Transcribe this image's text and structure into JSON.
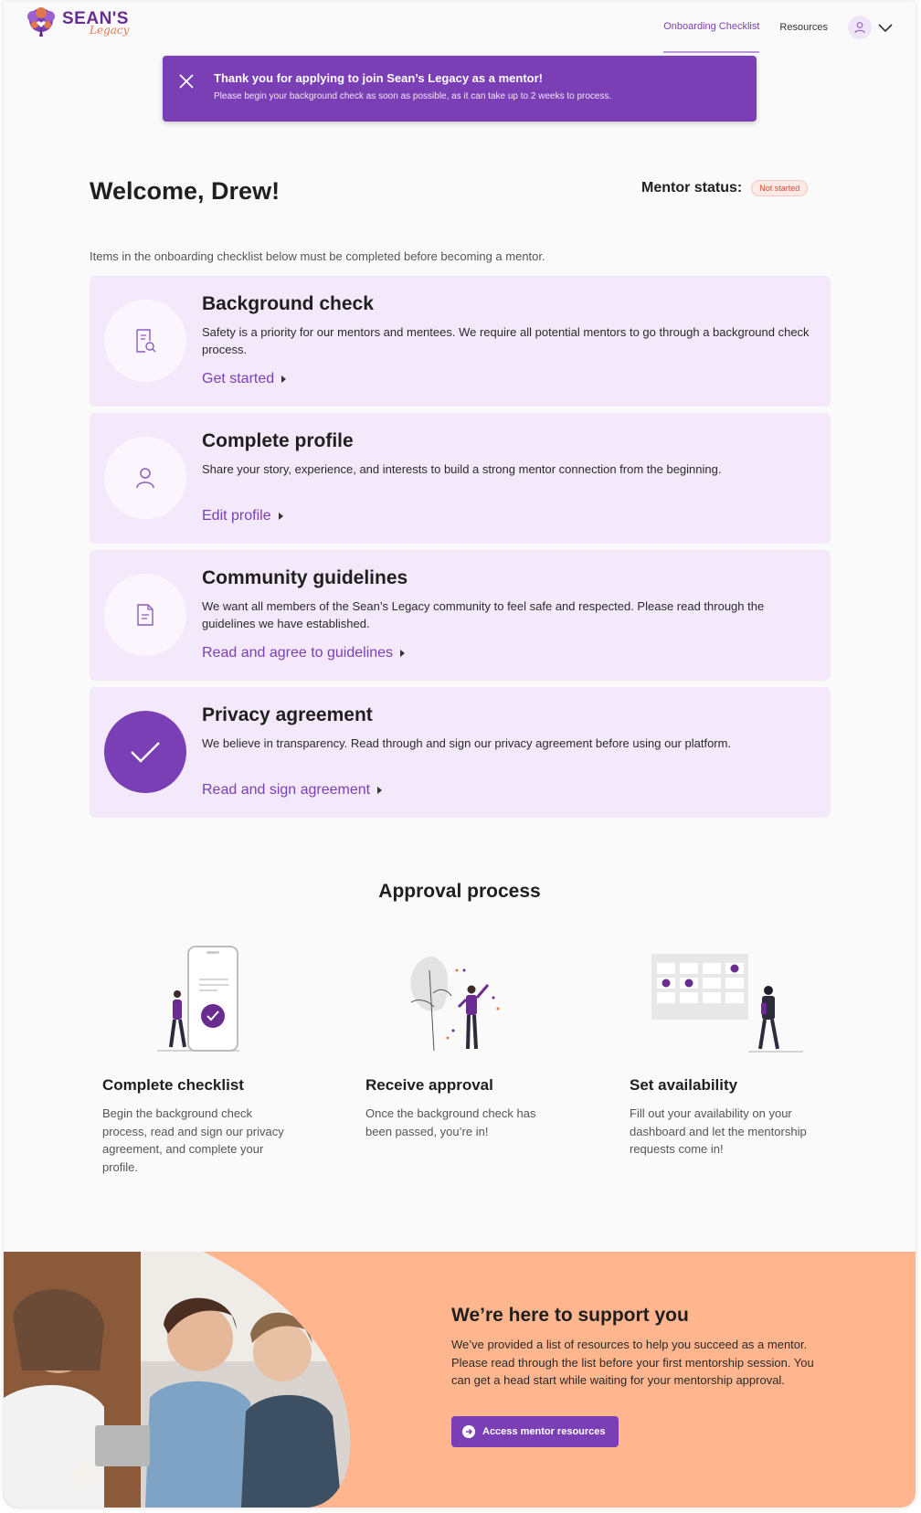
{
  "header": {
    "logo_primary": "SEAN'S",
    "logo_secondary": "Legacy",
    "nav": [
      {
        "label": "Onboarding Checklist",
        "active": true
      },
      {
        "label": "Resources",
        "active": false
      }
    ]
  },
  "banner": {
    "title": "Thank you for applying to join Sean’s Legacy as a mentor!",
    "subtitle": "Please begin your background check as soon as possible, as it can take up to 2 weeks to process."
  },
  "welcome": {
    "heading": "Welcome, Drew!",
    "status_label": "Mentor status:",
    "status_value": "Not started",
    "intro": "Items in the onboarding checklist below must be completed before becoming a mentor."
  },
  "checklist": [
    {
      "title": "Background check",
      "description": "Safety is a priority for our mentors and mentees. We require all potential mentors to go through a background check process.",
      "link": "Get started",
      "icon": "document-search-icon",
      "completed": false
    },
    {
      "title": "Complete profile",
      "description": "Share your story, experience, and interests to build a strong mentor connection from the beginning.",
      "link": "Edit profile",
      "icon": "user-icon",
      "completed": false
    },
    {
      "title": "Community guidelines",
      "description": "We want all members of the Sean’s Legacy community to feel safe and respected. Please read through the guidelines we have established.",
      "link": "Read and agree to guidelines",
      "icon": "document-icon",
      "completed": false
    },
    {
      "title": "Privacy agreement",
      "description": "We believe in transparency. Read through and sign our privacy agreement before using our platform.",
      "link": "Read and sign agreement",
      "icon": "checkmark-icon",
      "completed": true
    }
  ],
  "approval": {
    "heading": "Approval process",
    "steps": [
      {
        "title": "Complete checklist",
        "description": "Begin the background check process, read and sign our privacy agreement, and complete your profile."
      },
      {
        "title": "Receive approval",
        "description": "Once the background check has been passed, you’re in!"
      },
      {
        "title": "Set availability",
        "description": "Fill out your availability on your dashboard and let the mentorship requests come in!"
      }
    ]
  },
  "support": {
    "heading": "We’re here to support you",
    "description": "We’ve provided a list of resources to help you succeed as a mentor. Please read through the list before your first mentorship session. You can get a head start while waiting for your mentorship approval.",
    "button": "Access mentor resources"
  },
  "colors": {
    "accent": "#7b3fb5",
    "card_bg": "#f3e9fa",
    "footer_bg": "#ffb68e",
    "status_red": "#d04a3a"
  }
}
